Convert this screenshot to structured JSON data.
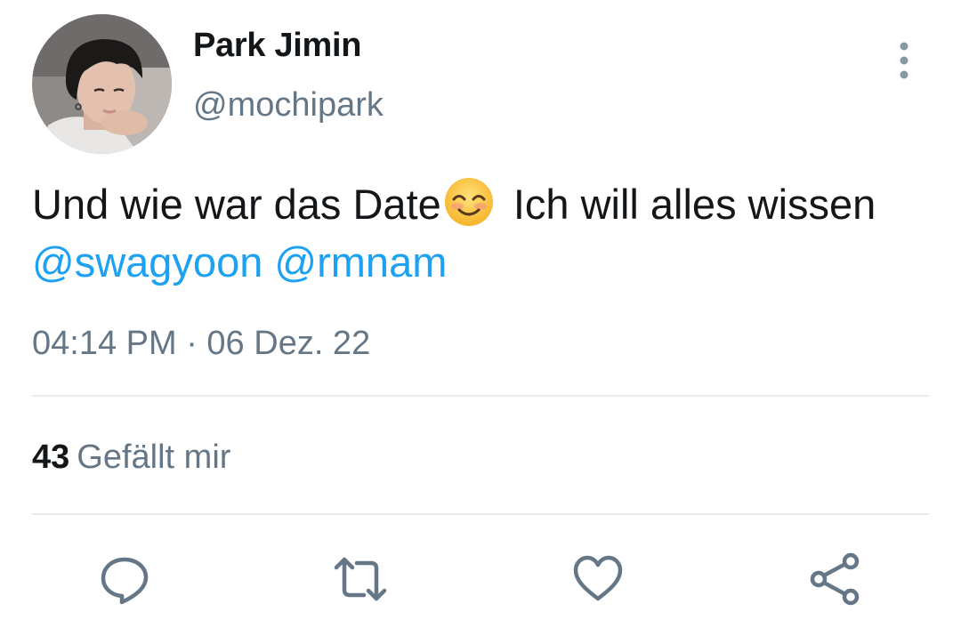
{
  "user": {
    "display_name": "Park Jimin",
    "handle": "@mochipark"
  },
  "tweet": {
    "text_part1": "Und wie war das Date",
    "emoji": "smiling-face-with-smiling-eyes",
    "text_part2": " Ich will alles wissen ",
    "mention_1": "@swagyoon",
    "mention_2": "@rmnam",
    "timestamp": "04:14 PM · 06 Dez. 22"
  },
  "stats": {
    "likes_count": "43",
    "likes_label": "Gefällt mir"
  },
  "actions": [
    "reply-icon",
    "retweet-icon",
    "like-icon",
    "share-icon"
  ],
  "colors": {
    "text": "#14171a",
    "secondary": "#657786",
    "link": "#1da1f2",
    "divider": "#e6ecf0"
  }
}
